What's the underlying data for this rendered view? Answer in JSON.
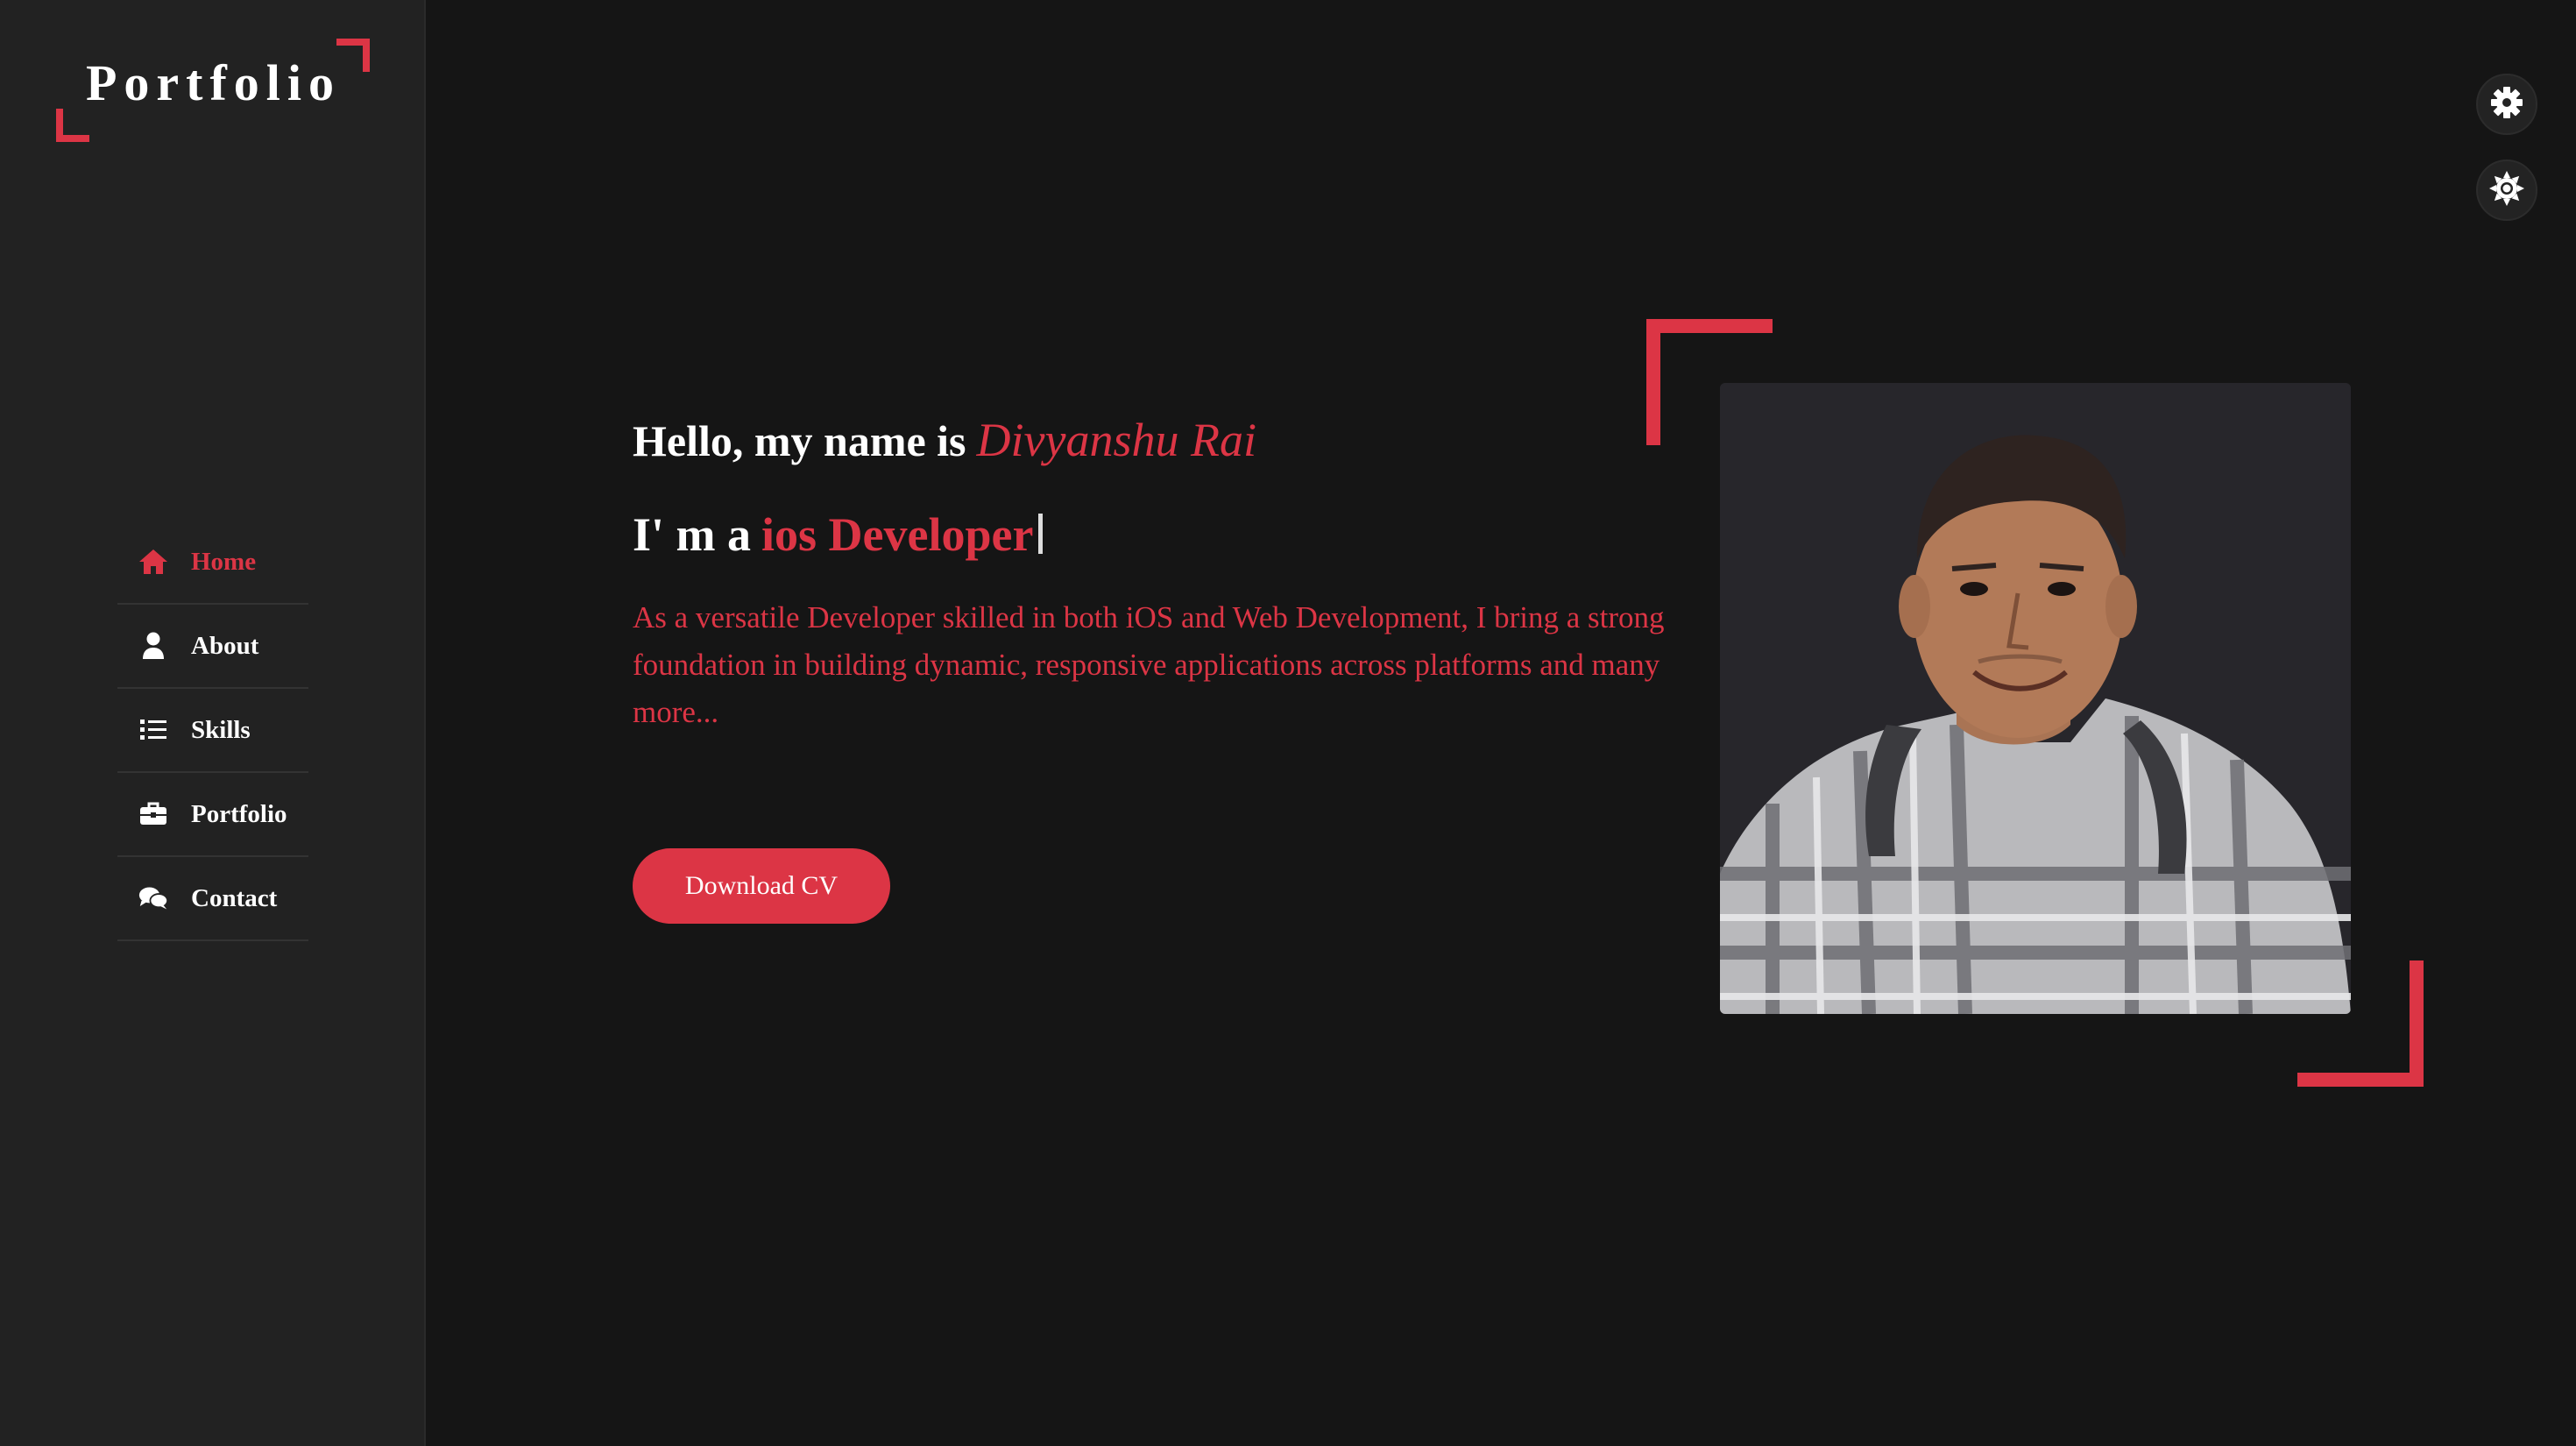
{
  "sidebar": {
    "logo": "Portfolio",
    "items": [
      {
        "label": "Home",
        "icon": "home-icon",
        "active": true
      },
      {
        "label": "About",
        "icon": "user-icon",
        "active": false
      },
      {
        "label": "Skills",
        "icon": "list-icon",
        "active": false
      },
      {
        "label": "Portfolio",
        "icon": "briefcase-icon",
        "active": false
      },
      {
        "label": "Contact",
        "icon": "comments-icon",
        "active": false
      }
    ]
  },
  "controls": {
    "settings_icon": "gear-icon",
    "theme_icon": "sun-icon"
  },
  "hero": {
    "greeting": "Hello, my name is",
    "name": "Divyanshu Rai",
    "role_prefix": "I' m a",
    "role": "ios Developer",
    "description": "As a versatile Developer skilled in both iOS and Web Development, I bring a strong foundation in building dynamic, responsive applications across platforms and many more...",
    "button_label": "Download CV"
  },
  "colors": {
    "accent": "#dc3545",
    "background": "#151515",
    "sidebar": "#222222",
    "text": "#ffffff"
  }
}
